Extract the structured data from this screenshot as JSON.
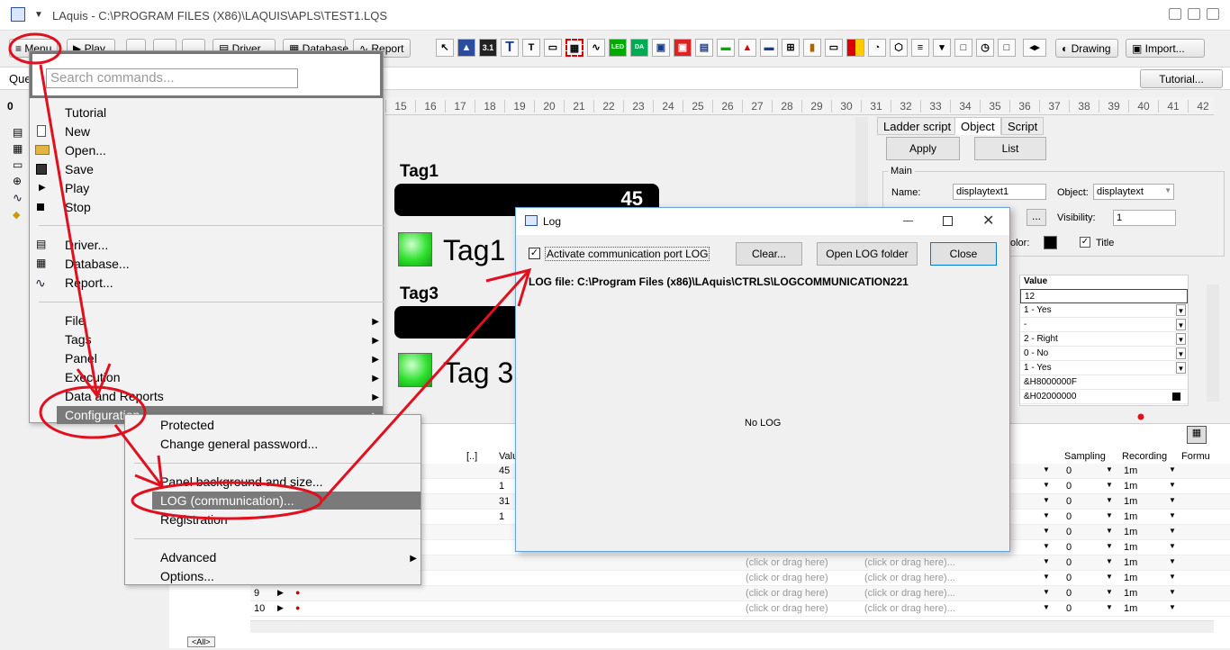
{
  "app": {
    "title": "LAquis - C:\\PROGRAM FILES (X86)\\LAQUIS\\APLS\\TEST1.LQS"
  },
  "toolbar": {
    "menu_label": "Menu",
    "play_label": "Play",
    "driver_label": "Driver",
    "database_label": "Database",
    "report_label": "Report",
    "drawing_label": "Drawing",
    "import_label": "Import...",
    "icon_texts": [
      "T",
      "T",
      "LED",
      "DA"
    ]
  },
  "quickbar": {
    "left_text": "Que",
    "tutorial_label": "Tutorial..."
  },
  "ruler": {
    "zero": "0",
    "ticks": [
      "15",
      "16",
      "17",
      "18",
      "19",
      "20",
      "21",
      "22",
      "23",
      "24",
      "25",
      "26",
      "27",
      "28",
      "29",
      "30",
      "31",
      "32",
      "33",
      "34",
      "35",
      "36",
      "37",
      "38",
      "39",
      "40",
      "41",
      "42"
    ]
  },
  "canvas": {
    "tag1_title": "Tag1",
    "tag1_value": "45",
    "led1_label": "Tag1",
    "tag3_title": "Tag3",
    "led3_label": "Tag 3"
  },
  "search": {
    "placeholder": "Search commands..."
  },
  "main_menu": {
    "items_group1": [
      "Tutorial",
      "New",
      "Open...",
      "Save",
      "Play",
      "Stop"
    ],
    "items_group2": [
      "Driver...",
      "Database...",
      "Report..."
    ],
    "items_group3": [
      "File",
      "Tags",
      "Panel",
      "Execution",
      "Data and Reports",
      "Configuration"
    ]
  },
  "config_submenu": {
    "group1": [
      "Protected",
      "Change general password..."
    ],
    "group2": [
      "Panel background and size...",
      "LOG (communication)...",
      "Registration"
    ],
    "group3": [
      "Advanced",
      "Options..."
    ]
  },
  "log_dialog": {
    "title": "Log",
    "checkbox_label": "Activate communication port LOG",
    "checkbox_checked": true,
    "clear_label": "Clear...",
    "open_folder_label": "Open LOG folder",
    "close_label": "Close",
    "log_file_text": "LOG file: C:\\Program Files (x86)\\LAquis\\CTRLS\\LOGCOMMUNICATION221",
    "content_text": "No LOG"
  },
  "right_panel": {
    "tabs": [
      "Ladder script",
      "Object",
      "Script"
    ],
    "active_tab": "Object",
    "apply_label": "Apply",
    "list_label": "List",
    "main_group": "Main",
    "name_label": "Name:",
    "name_value": "displaytext1",
    "object_label": "Object:",
    "object_value": "displaytext",
    "ellipsis": "...",
    "visibility_label": "Visibility:",
    "visibility_value": "1",
    "color_label": "olor:",
    "title_check_label": "Title",
    "value_header": "Value",
    "values": [
      "12",
      "1 - Yes",
      "-",
      "2 - Right",
      "0 - No",
      "1 - Yes",
      "&H8000000F",
      "&H02000000"
    ]
  },
  "bottom_grid": {
    "tab_label": "<All>",
    "header_bracket": "[..]",
    "header_value": "Valu",
    "header_sampling": "Sampling",
    "header_recording": "Recording",
    "header_formula": "Formu",
    "value_cells": [
      "45",
      "1",
      "31",
      "1"
    ],
    "row_numbers": [
      "9",
      "10"
    ],
    "click_text_a": "(click or drag here)",
    "click_text_b": "(click or drag here)...",
    "sampling_value": "0",
    "recording_value": "1m"
  },
  "colors": {
    "annotation_red": "#e0101e",
    "dialog_border": "#6a9fd8",
    "led_green": "#2ee02e"
  }
}
